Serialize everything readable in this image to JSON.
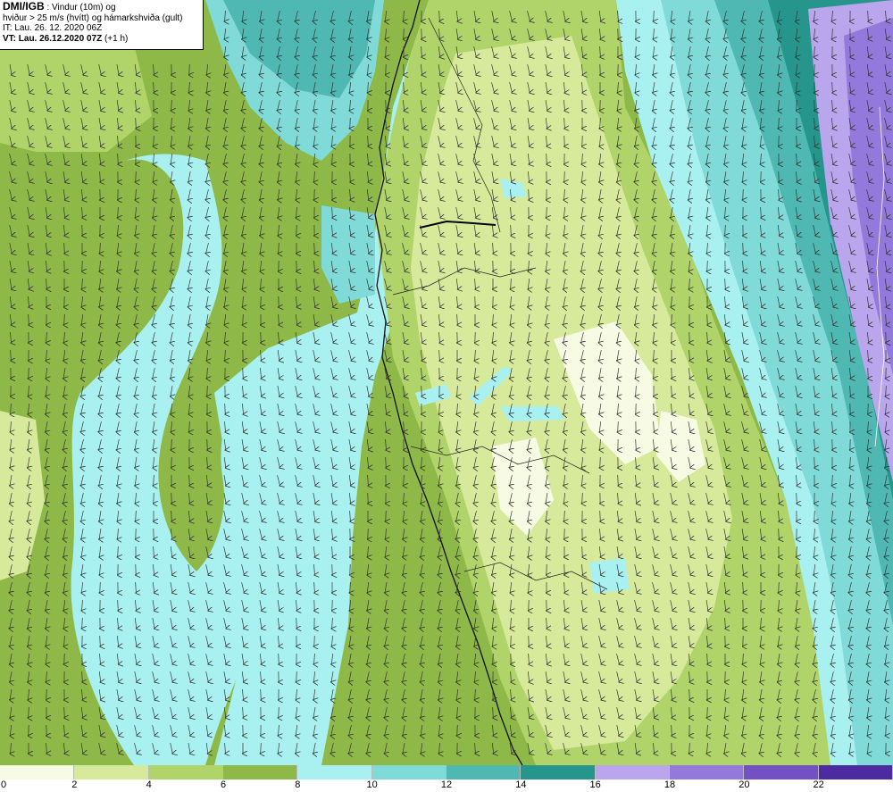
{
  "info": {
    "source": "DMI/IGB",
    "title_rest": " : Vindur (10m) og",
    "line2": "hviður > 25 m/s (hvítt) og hámarkshviða (gult)",
    "line3": "IT: Lau. 26. 12. 2020 06Z",
    "vt_label": "VT: Lau. 26.12.2020 07Z",
    "vt_offset": " (+1 h)"
  },
  "legend": {
    "classes": [
      {
        "from": 0,
        "to": 2,
        "color": "#f7fbe3"
      },
      {
        "from": 2,
        "to": 4,
        "color": "#d7ea9b"
      },
      {
        "from": 4,
        "to": 6,
        "color": "#b0d36a"
      },
      {
        "from": 6,
        "to": 8,
        "color": "#8eb847"
      },
      {
        "from": 8,
        "to": 10,
        "color": "#a9f1f1"
      },
      {
        "from": 10,
        "to": 12,
        "color": "#80dad8"
      },
      {
        "from": 12,
        "to": 14,
        "color": "#4fb8b3"
      },
      {
        "from": 14,
        "to": 16,
        "color": "#26958c"
      },
      {
        "from": 16,
        "to": 18,
        "color": "#b9a6ec"
      },
      {
        "from": 18,
        "to": 20,
        "color": "#9479dc"
      },
      {
        "from": 20,
        "to": 22,
        "color": "#7350c4"
      },
      {
        "from": 22,
        "to": 24,
        "color": "#4c2a9f"
      }
    ],
    "tick_labels": [
      "0",
      "2",
      "4",
      "6",
      "8",
      "10",
      "12",
      "14",
      "16",
      "18",
      "20",
      "22"
    ]
  },
  "map": {
    "wind_direction": "from north",
    "coastline_color": "#111111"
  }
}
